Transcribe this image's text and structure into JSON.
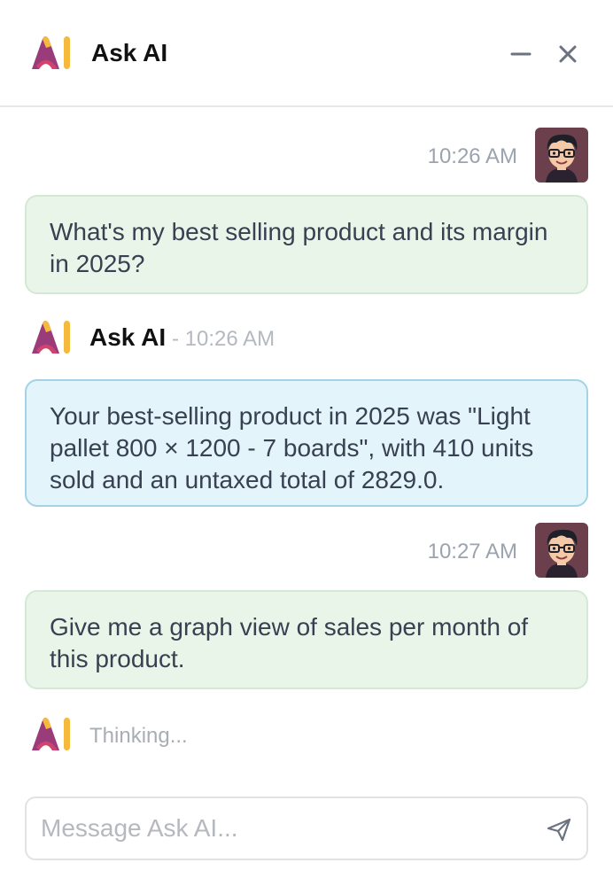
{
  "header": {
    "title": "Ask AI",
    "logo_icon": "ask-ai-logo",
    "minimize_icon": "minimize-icon",
    "close_icon": "close-icon"
  },
  "messages": [
    {
      "role": "user",
      "time": "10:26 AM",
      "text": "What's my best selling product and its margin in 2025?"
    },
    {
      "role": "assistant",
      "name": "Ask AI",
      "time": "- 10:26 AM",
      "text": "Your best-selling product in 2025 was \"Light pallet 800 × 1200 - 7 boards\", with 410 units sold and an untaxed total of 2829.0."
    },
    {
      "role": "user",
      "time": "10:27 AM",
      "text": "Give me a graph view of sales per month of this product."
    }
  ],
  "status": {
    "thinking": "Thinking..."
  },
  "composer": {
    "placeholder": "Message Ask AI...",
    "value": "",
    "send_icon": "send-icon"
  },
  "colors": {
    "user_bubble": "#eaf5ea",
    "ai_bubble": "#e3f4fb",
    "logo_purple": "#9a3b7a",
    "logo_yellow": "#f4b93d"
  }
}
